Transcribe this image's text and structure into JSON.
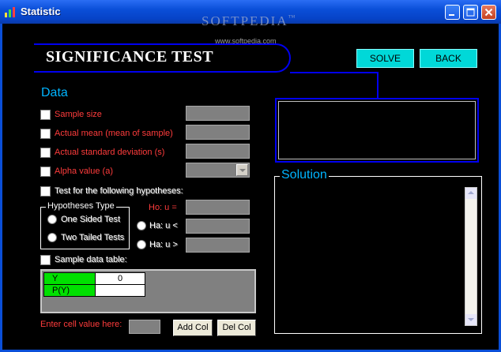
{
  "window": {
    "title": "Statistic",
    "watermark": "SOFTPEDIA",
    "watermark_tm": "™",
    "watermark_url": "www.softpedia.com"
  },
  "header": {
    "title": "SIGNIFICANCE TEST",
    "solve_label": "SOLVE",
    "back_label": "BACK"
  },
  "data_section": {
    "label": "Data",
    "fields": [
      {
        "label": "Sample size",
        "value": ""
      },
      {
        "label": "Actual mean (mean of sample)",
        "value": ""
      },
      {
        "label": "Actual standard deviation (s)",
        "value": ""
      },
      {
        "label": "Alpha value (a)",
        "value": ""
      }
    ],
    "test_hypotheses_label": "Test for the following hypotheses:",
    "hypotheses_type": {
      "label": "Hypotheses Type",
      "options": [
        "One Sided Test",
        "Two Tailed Tests"
      ]
    },
    "hypotheses": {
      "h0_label": "Ho: u =",
      "ha1_label": "Ha: u <",
      "ha2_label": "Ha: u >"
    },
    "sample_table_label": "Sample data table:",
    "table": {
      "rows": [
        {
          "header": "Y",
          "value": "0"
        },
        {
          "header": "P(Y)",
          "value": ""
        }
      ]
    },
    "cell_entry_label": "Enter cell value here:",
    "add_col_label": "Add Col",
    "del_col_label": "Del Col"
  },
  "solution": {
    "label": "Solution"
  },
  "colors": {
    "accent_blue": "#0000f0",
    "label_red": "#ff3c3c",
    "section_cyan": "#00b4ff",
    "button_cyan": "#00d8d8",
    "table_header_green": "#00e000"
  }
}
